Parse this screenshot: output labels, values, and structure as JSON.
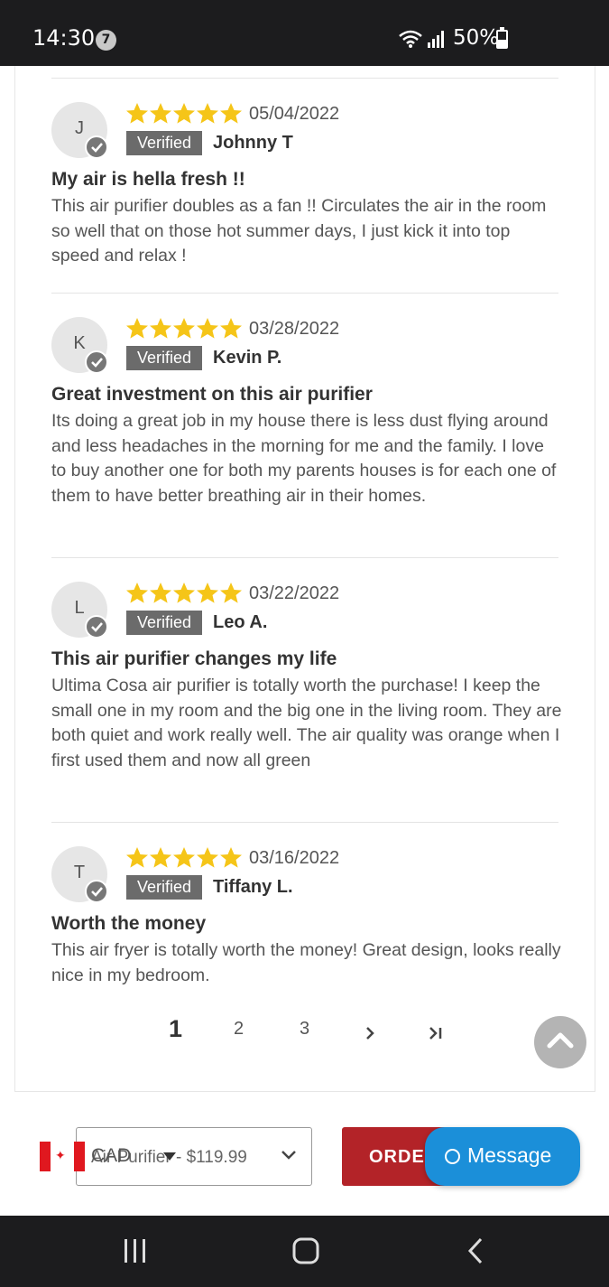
{
  "status_bar": {
    "time": "14:30",
    "notification_count": "7",
    "battery": "50%",
    "battery_level": 0.5,
    "icons": [
      "wifi-icon",
      "signal-icon",
      "battery-icon"
    ]
  },
  "reviews": [
    {
      "initial": "J",
      "rating": 5,
      "date": "05/04/2022",
      "verified_label": "Verified",
      "author": "Johnny T",
      "title": "My air is hella fresh !!",
      "body": "This air purifier doubles as a fan !! Circulates the air in the room so well that on those hot summer days, I just kick it into top speed and relax !"
    },
    {
      "initial": "K",
      "rating": 5,
      "date": "03/28/2022",
      "verified_label": "Verified",
      "author": "Kevin P.",
      "title": "Great investment on this air purifier",
      "body": "Its doing a great job in my house there is less dust flying around and less headaches in the morning for me and the family. I love to buy another one for both my parents houses is for each one of them to have better breathing air in their homes."
    },
    {
      "initial": "L",
      "rating": 5,
      "date": "03/22/2022",
      "verified_label": "Verified",
      "author": "Leo A.",
      "title": "This air purifier changes my life",
      "body": "Ultima Cosa air purifier is totally worth the purchase! I keep the small one in my room and the big one in the living room. They are both quiet and work really well. The air quality was orange when I first used them and now all green"
    },
    {
      "initial": "T",
      "rating": 5,
      "date": "03/16/2022",
      "verified_label": "Verified",
      "author": "Tiffany L.",
      "title": "Worth the money",
      "body": "This air fryer is totally worth the money! Great design, looks really nice in my bedroom."
    }
  ],
  "pagination": {
    "pages": [
      "1",
      "2",
      "3"
    ],
    "current": "1",
    "next_icon": "chevron-right-icon",
    "last_icon": "last-page-icon"
  },
  "bottom_bar": {
    "currency": "CAD",
    "product_option": "Air Purifier - $119.99",
    "order_label": "ORDER",
    "message_label": "Message"
  },
  "colors": {
    "star": "#f5c518",
    "verified_bg": "#6b6b6b",
    "order_bg": "#b32328",
    "message_bg": "#1b8fd9"
  }
}
